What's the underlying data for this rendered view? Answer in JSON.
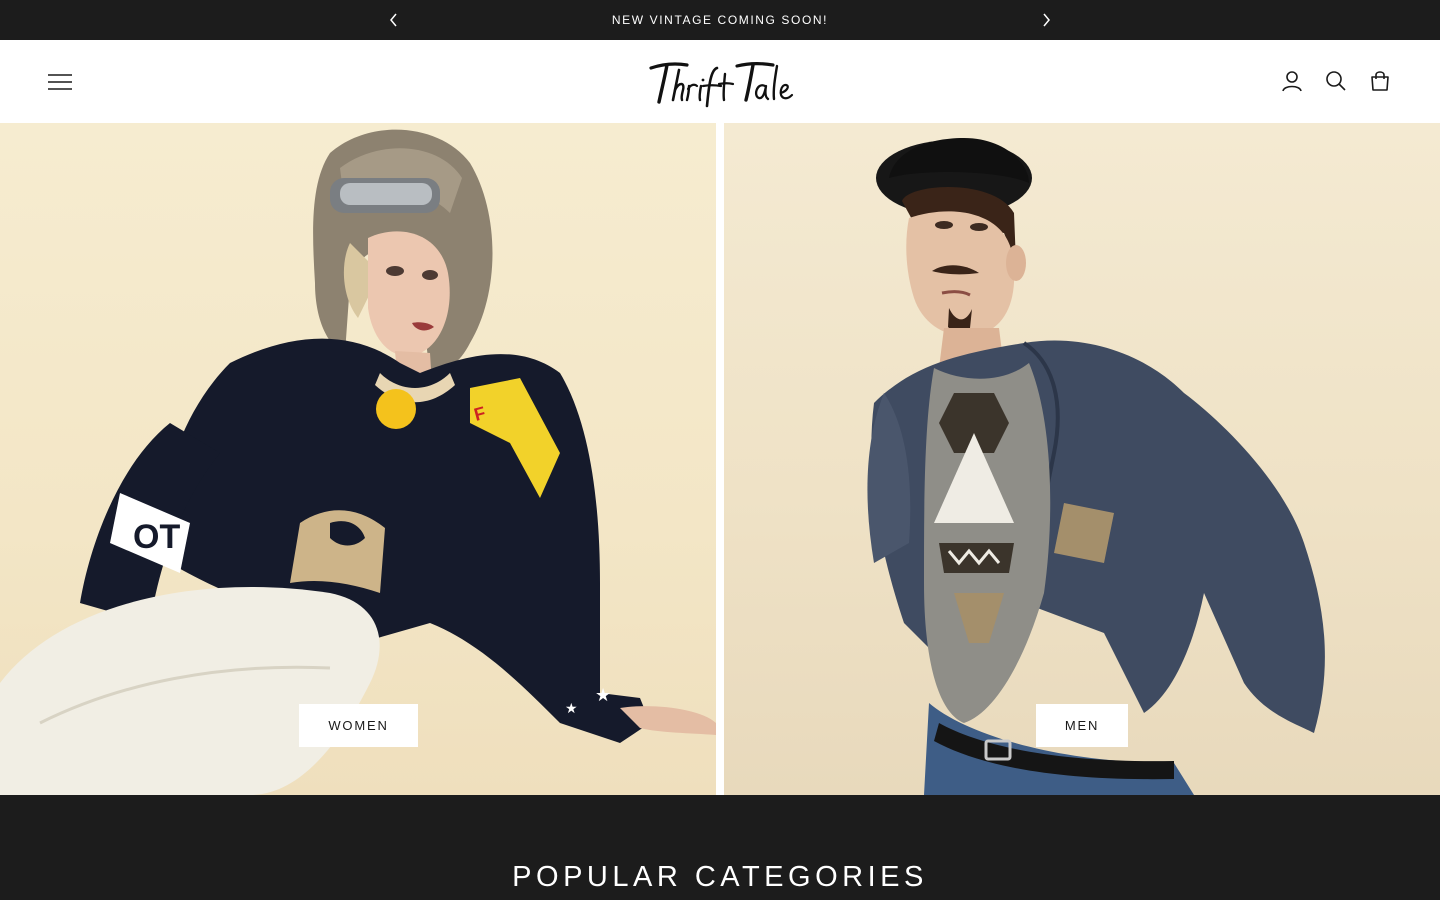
{
  "announcement": {
    "text": "NEW VINTAGE COMING SOON!",
    "prev_icon": "chevron-left-icon",
    "next_icon": "chevron-right-icon"
  },
  "header": {
    "logo_text": "Thrift Tale",
    "menu_icon": "hamburger-menu-icon",
    "icons": [
      "account-icon",
      "search-icon",
      "cart-bag-icon"
    ]
  },
  "hero": {
    "panels": [
      {
        "label": "WOMEN"
      },
      {
        "label": "MEN"
      }
    ]
  },
  "popular": {
    "title": "POPULAR CATEGORIES"
  },
  "colors": {
    "dark": "#1c1c1c",
    "white": "#ffffff",
    "cream": "#f4e9cf"
  }
}
